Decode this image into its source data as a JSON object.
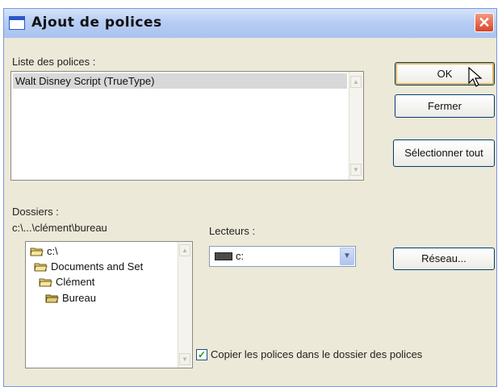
{
  "window": {
    "title": "Ajout de polices",
    "close_symbol": "✕"
  },
  "fonts_list": {
    "label": "Liste des polices :",
    "items": [
      "Walt Disney Script (TrueType)"
    ]
  },
  "buttons": {
    "ok": "OK",
    "close": "Fermer",
    "select_all": "Sélectionner tout",
    "network": "Réseau..."
  },
  "folders": {
    "label": "Dossiers :",
    "current_path": "c:\\...\\clément\\bureau",
    "tree": [
      {
        "label": "c:\\",
        "icon": "open-folder-icon"
      },
      {
        "label": "Documents and Set",
        "icon": "open-folder-icon"
      },
      {
        "label": "Clément",
        "icon": "open-folder-icon"
      },
      {
        "label": "Bureau",
        "icon": "open-folder-icon"
      }
    ]
  },
  "drives": {
    "label": "Lecteurs :",
    "selected": "c:",
    "icon": "hard-drive-icon"
  },
  "copy_option": {
    "label": "Copier les polices dans le dossier des polices",
    "checked": true
  },
  "colors": {
    "dialog_bg": "#ece9d8",
    "titlebar": "#b7cdf4",
    "close_button": "#d8452a",
    "default_button_focus": "#e9b558",
    "selection": "#d8d8d8"
  }
}
